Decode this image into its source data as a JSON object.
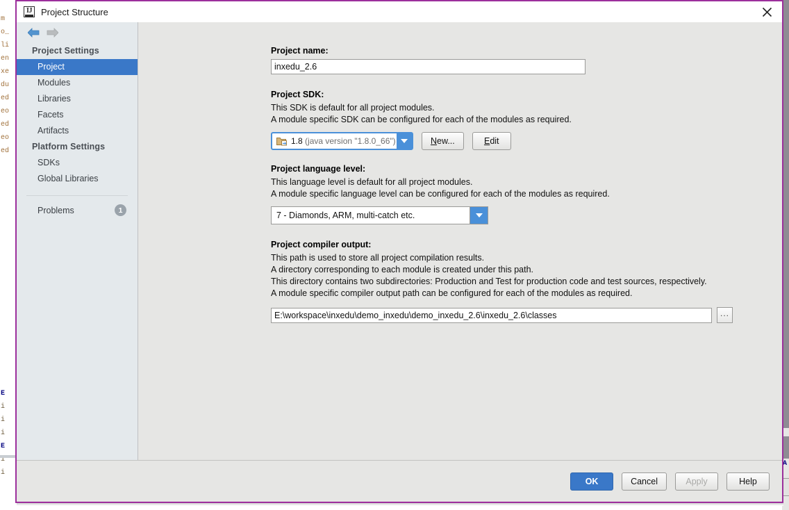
{
  "window": {
    "title": "Project Structure",
    "app_icon": "intellij-idea-icon",
    "close_icon": "close-icon",
    "border_color": "#9c2f9c"
  },
  "nav": {
    "back_icon": "arrow-left-icon",
    "forward_icon": "arrow-right-icon"
  },
  "sidebar": {
    "groups": [
      {
        "header": "Project Settings",
        "items": [
          {
            "label": "Project",
            "selected": true
          },
          {
            "label": "Modules",
            "selected": false
          },
          {
            "label": "Libraries",
            "selected": false
          },
          {
            "label": "Facets",
            "selected": false
          },
          {
            "label": "Artifacts",
            "selected": false
          }
        ]
      },
      {
        "header": "Platform Settings",
        "items": [
          {
            "label": "SDKs",
            "selected": false
          },
          {
            "label": "Global Libraries",
            "selected": false
          }
        ]
      }
    ],
    "problems": {
      "label": "Problems",
      "count": "1"
    },
    "accent_selected": "#3a78c8"
  },
  "main": {
    "project_name": {
      "title": "Project name:",
      "value": "inxedu_2.6",
      "placeholder": ""
    },
    "project_sdk": {
      "title": "Project SDK:",
      "description_lines": [
        "This SDK is default for all project modules.",
        "A module specific SDK can be configured for each of the modules as required."
      ],
      "icon": "sdk-folder-icon",
      "selected_version": "1.8",
      "selected_note": "(java version \"1.8.0_66\")",
      "dropdown_icon": "chevron-down-icon",
      "new_button": {
        "prefix": "",
        "mnemonic": "N",
        "suffix": "ew..."
      },
      "edit_button": {
        "prefix": "",
        "mnemonic": "E",
        "suffix": "dit"
      },
      "focus_color": "#4a90d9"
    },
    "language_level": {
      "title": "Project language level:",
      "description_lines": [
        "This language level is default for all project modules.",
        "A module specific language level can be configured for each of the modules as required."
      ],
      "selected": "7 - Diamonds, ARM, multi-catch etc.",
      "dropdown_icon": "chevron-down-icon"
    },
    "compiler_output": {
      "title": "Project compiler output:",
      "description_lines": [
        "This path is used to store all project compilation results.",
        "A directory corresponding to each module is created under this path.",
        "This directory contains two subdirectories: Production and Test for production code and test sources, respectively.",
        "A module specific compiler output path can be configured for each of the modules as required."
      ],
      "value": "E:\\workspace\\inxedu\\demo_inxedu\\demo_inxedu_2.6\\inxedu_2.6\\classes",
      "browse_label": "...",
      "browse_icon": "ellipsis-browse-icon"
    }
  },
  "footer": {
    "ok": "OK",
    "cancel": "Cancel",
    "apply": "Apply",
    "help": "Help",
    "apply_disabled": true,
    "ok_color": "#3a78c8"
  },
  "backdrop": {
    "left_lines": [
      "m",
      "o_",
      "li",
      "en",
      "xe",
      "du",
      "ed",
      "eo",
      "ed",
      "eo"
    ],
    "bottom_lines": [
      "E",
      "i",
      "i",
      "i",
      "E",
      "i",
      "i"
    ],
    "right_letter": "A"
  }
}
